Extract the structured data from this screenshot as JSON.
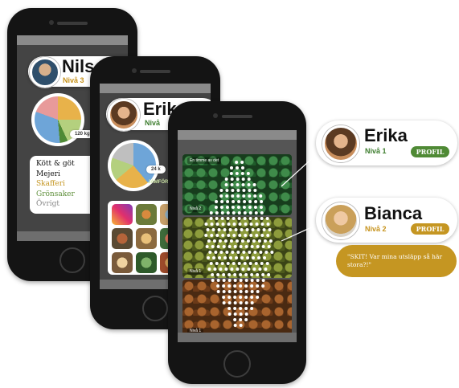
{
  "phone_left": {
    "profile": {
      "name": "Nils",
      "level": "Nivå 3"
    },
    "pie_label": "120 kg CO",
    "legend": [
      {
        "label": "Kött & göt",
        "color": "#111111"
      },
      {
        "label": "Mejeri",
        "color": "#111111"
      },
      {
        "label": "Skafferi",
        "color": "#c59622"
      },
      {
        "label": "Grönsaker",
        "color": "#5e8f3a"
      },
      {
        "label": "Övrigt",
        "color": "#888888"
      }
    ]
  },
  "phone_middle": {
    "profile": {
      "name": "Erik",
      "level": "Nivå"
    },
    "pie_label": "24 k",
    "green_label": "JÄMFÖR"
  },
  "phone_front": {
    "segment_labels": [
      "Nivå 2",
      "Nivå 1",
      "Nivå 1"
    ],
    "top_label": "En timme av det"
  },
  "users": [
    {
      "name": "Erika",
      "level": "Nivå 1",
      "button": "PROFIL",
      "button_color": "#4f8a35",
      "level_color": "#3d7d2e"
    },
    {
      "name": "Bianca",
      "level": "Nivå 2",
      "button": "PROFIL",
      "button_color": "#c59622",
      "level_color": "#c6921b"
    }
  ],
  "speech_bubble": "\"SKIT! Var mina utsläpp så här stora?!\"",
  "colors": {
    "green": "#4f8a35",
    "gold": "#c59622"
  }
}
